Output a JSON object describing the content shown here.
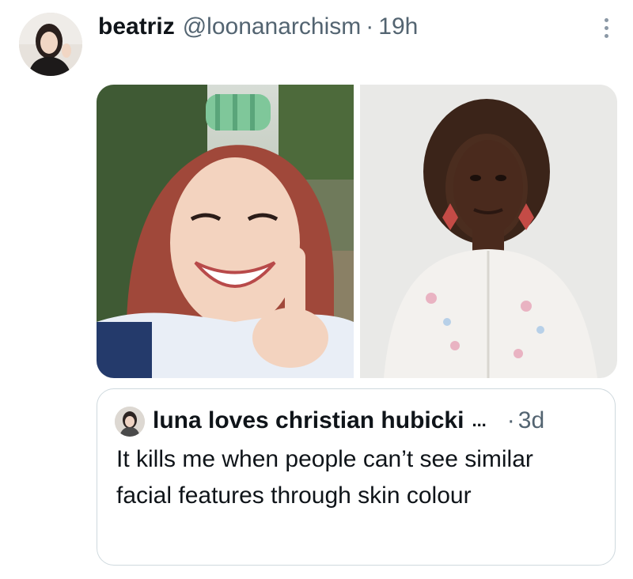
{
  "tweet": {
    "author": {
      "display_name": "beatriz",
      "handle": "@loonanarchism",
      "separator": "·",
      "time": "19h",
      "avatar_icon": "user-avatar"
    },
    "more_icon": "more-vertical-icon",
    "media": [
      {
        "icon": "photo-woman-with-hair-roller"
      },
      {
        "icon": "photo-woman-in-cardigan"
      }
    ],
    "quote": {
      "author": {
        "display_name": "luna loves christian hubicki",
        "ellipsis": "...",
        "separator": "·",
        "time": "3d",
        "avatar_icon": "quoted-user-avatar"
      },
      "text": "It kills me when people can’t see similar facial features through skin colour"
    }
  },
  "colors": {
    "text_primary": "#0f1419",
    "text_secondary": "#536471",
    "border": "#cfd9de",
    "background": "#ffffff"
  }
}
